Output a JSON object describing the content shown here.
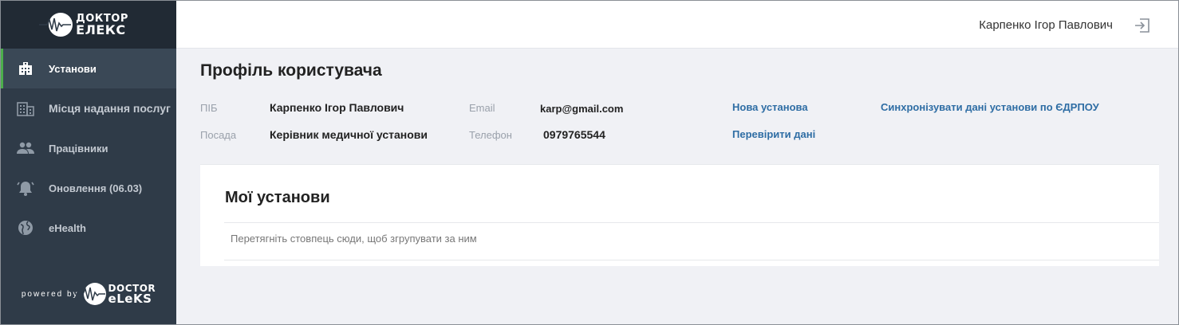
{
  "brand": {
    "line1": "ДОКТОР",
    "line2": "ЕЛЕКС"
  },
  "sidebar": {
    "items": [
      {
        "label": "Установи",
        "icon": "building-icon",
        "active": true
      },
      {
        "label": "Місця надання послуг",
        "icon": "office-icon",
        "active": false
      },
      {
        "label": "Працівники",
        "icon": "people-icon",
        "active": false
      },
      {
        "label": "Оновлення (06.03)",
        "icon": "bell-icon",
        "active": false
      },
      {
        "label": "eHealth",
        "icon": "globe-icon",
        "active": false
      }
    ],
    "powered_by": "powered by",
    "powered_logo": {
      "line1": "DOCTOR",
      "line2": "eLeKS"
    }
  },
  "header": {
    "user_name": "Карпенко Ігор Павлович",
    "logout_icon": "logout-icon"
  },
  "profile": {
    "title": "Профіль користувача",
    "pib_label": "ПІБ",
    "pib_value": "Карпенко Ігор Павлович",
    "position_label": "Посада",
    "position_value": "Керівник медичної установи",
    "email_label": "Email",
    "email_value": "karp@gmail.com",
    "phone_label": "Телефон",
    "phone_value": "0979765544",
    "link_new": "Нова установа",
    "link_check": "Перевірити дані",
    "link_sync": "Синхронізувати дані установи по ЄДРПОУ"
  },
  "institutions": {
    "title": "Мої установи",
    "group_hint": "Перетягніть стовпець сюди, щоб згрупувати за ним"
  },
  "colors": {
    "sidebar": "#2f3b48",
    "brand_bg": "#212a34",
    "active_accent": "#4cae4c",
    "link": "#2e6da4"
  }
}
